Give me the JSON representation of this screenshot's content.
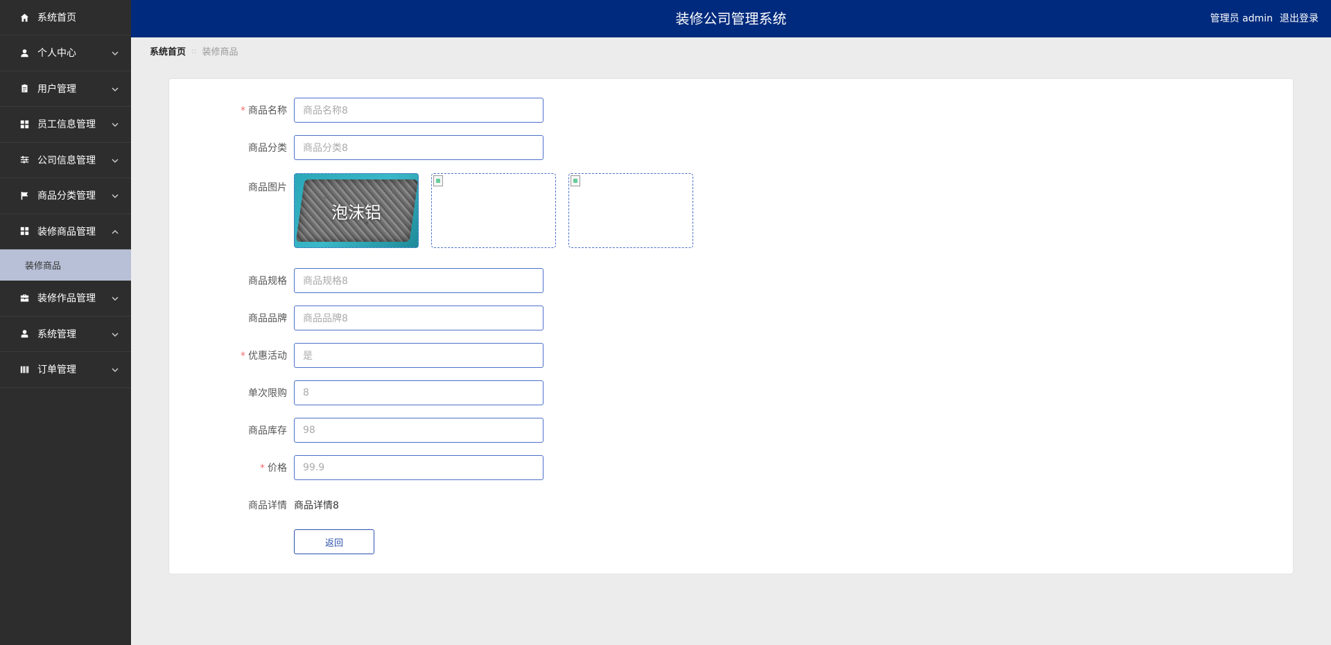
{
  "app": {
    "title": "装修公司管理系统",
    "user_label": "管理员 admin",
    "logout_label": "退出登录"
  },
  "sidebar": {
    "items": [
      {
        "label": "系统首页",
        "icon": "home-icon",
        "expandable": false
      },
      {
        "label": "个人中心",
        "icon": "user-icon",
        "expandable": true
      },
      {
        "label": "用户管理",
        "icon": "clipboard-icon",
        "expandable": true
      },
      {
        "label": "员工信息管理",
        "icon": "grid-icon",
        "expandable": true
      },
      {
        "label": "公司信息管理",
        "icon": "sliders-icon",
        "expandable": true
      },
      {
        "label": "商品分类管理",
        "icon": "flag-icon",
        "expandable": true
      },
      {
        "label": "装修商品管理",
        "icon": "grid-icon",
        "expandable": true,
        "expanded": true
      },
      {
        "label": "装修作品管理",
        "icon": "briefcase-icon",
        "expandable": true
      },
      {
        "label": "系统管理",
        "icon": "person-icon",
        "expandable": true
      },
      {
        "label": "订单管理",
        "icon": "bars-icon",
        "expandable": true
      }
    ],
    "active_sub": "装修商品"
  },
  "breadcrumb": {
    "home": "系统首页",
    "separator": "::",
    "current": "装修商品"
  },
  "form": {
    "name": {
      "label": "商品名称",
      "required": true,
      "value": "商品名称8"
    },
    "category": {
      "label": "商品分类",
      "required": false,
      "value": "商品分类8"
    },
    "image": {
      "label": "商品图片",
      "caption": "泡沫铝"
    },
    "spec": {
      "label": "商品规格",
      "required": false,
      "value": "商品规格8"
    },
    "brand": {
      "label": "商品品牌",
      "required": false,
      "value": "商品品牌8"
    },
    "promo": {
      "label": "优惠活动",
      "required": true,
      "value": "是"
    },
    "limit": {
      "label": "单次限购",
      "required": false,
      "value": "8"
    },
    "stock": {
      "label": "商品库存",
      "required": false,
      "value": "98"
    },
    "price": {
      "label": "价格",
      "required": true,
      "value": "99.9"
    },
    "detail": {
      "label": "商品详情",
      "value": "商品详情8"
    },
    "back_button": "返回"
  },
  "colors": {
    "header_bg": "#002a7d",
    "sidebar_bg": "#2d2d2d",
    "active_sub_bg": "#b7c0d6",
    "input_border": "#4a6fc9",
    "required": "#f56c6c"
  }
}
